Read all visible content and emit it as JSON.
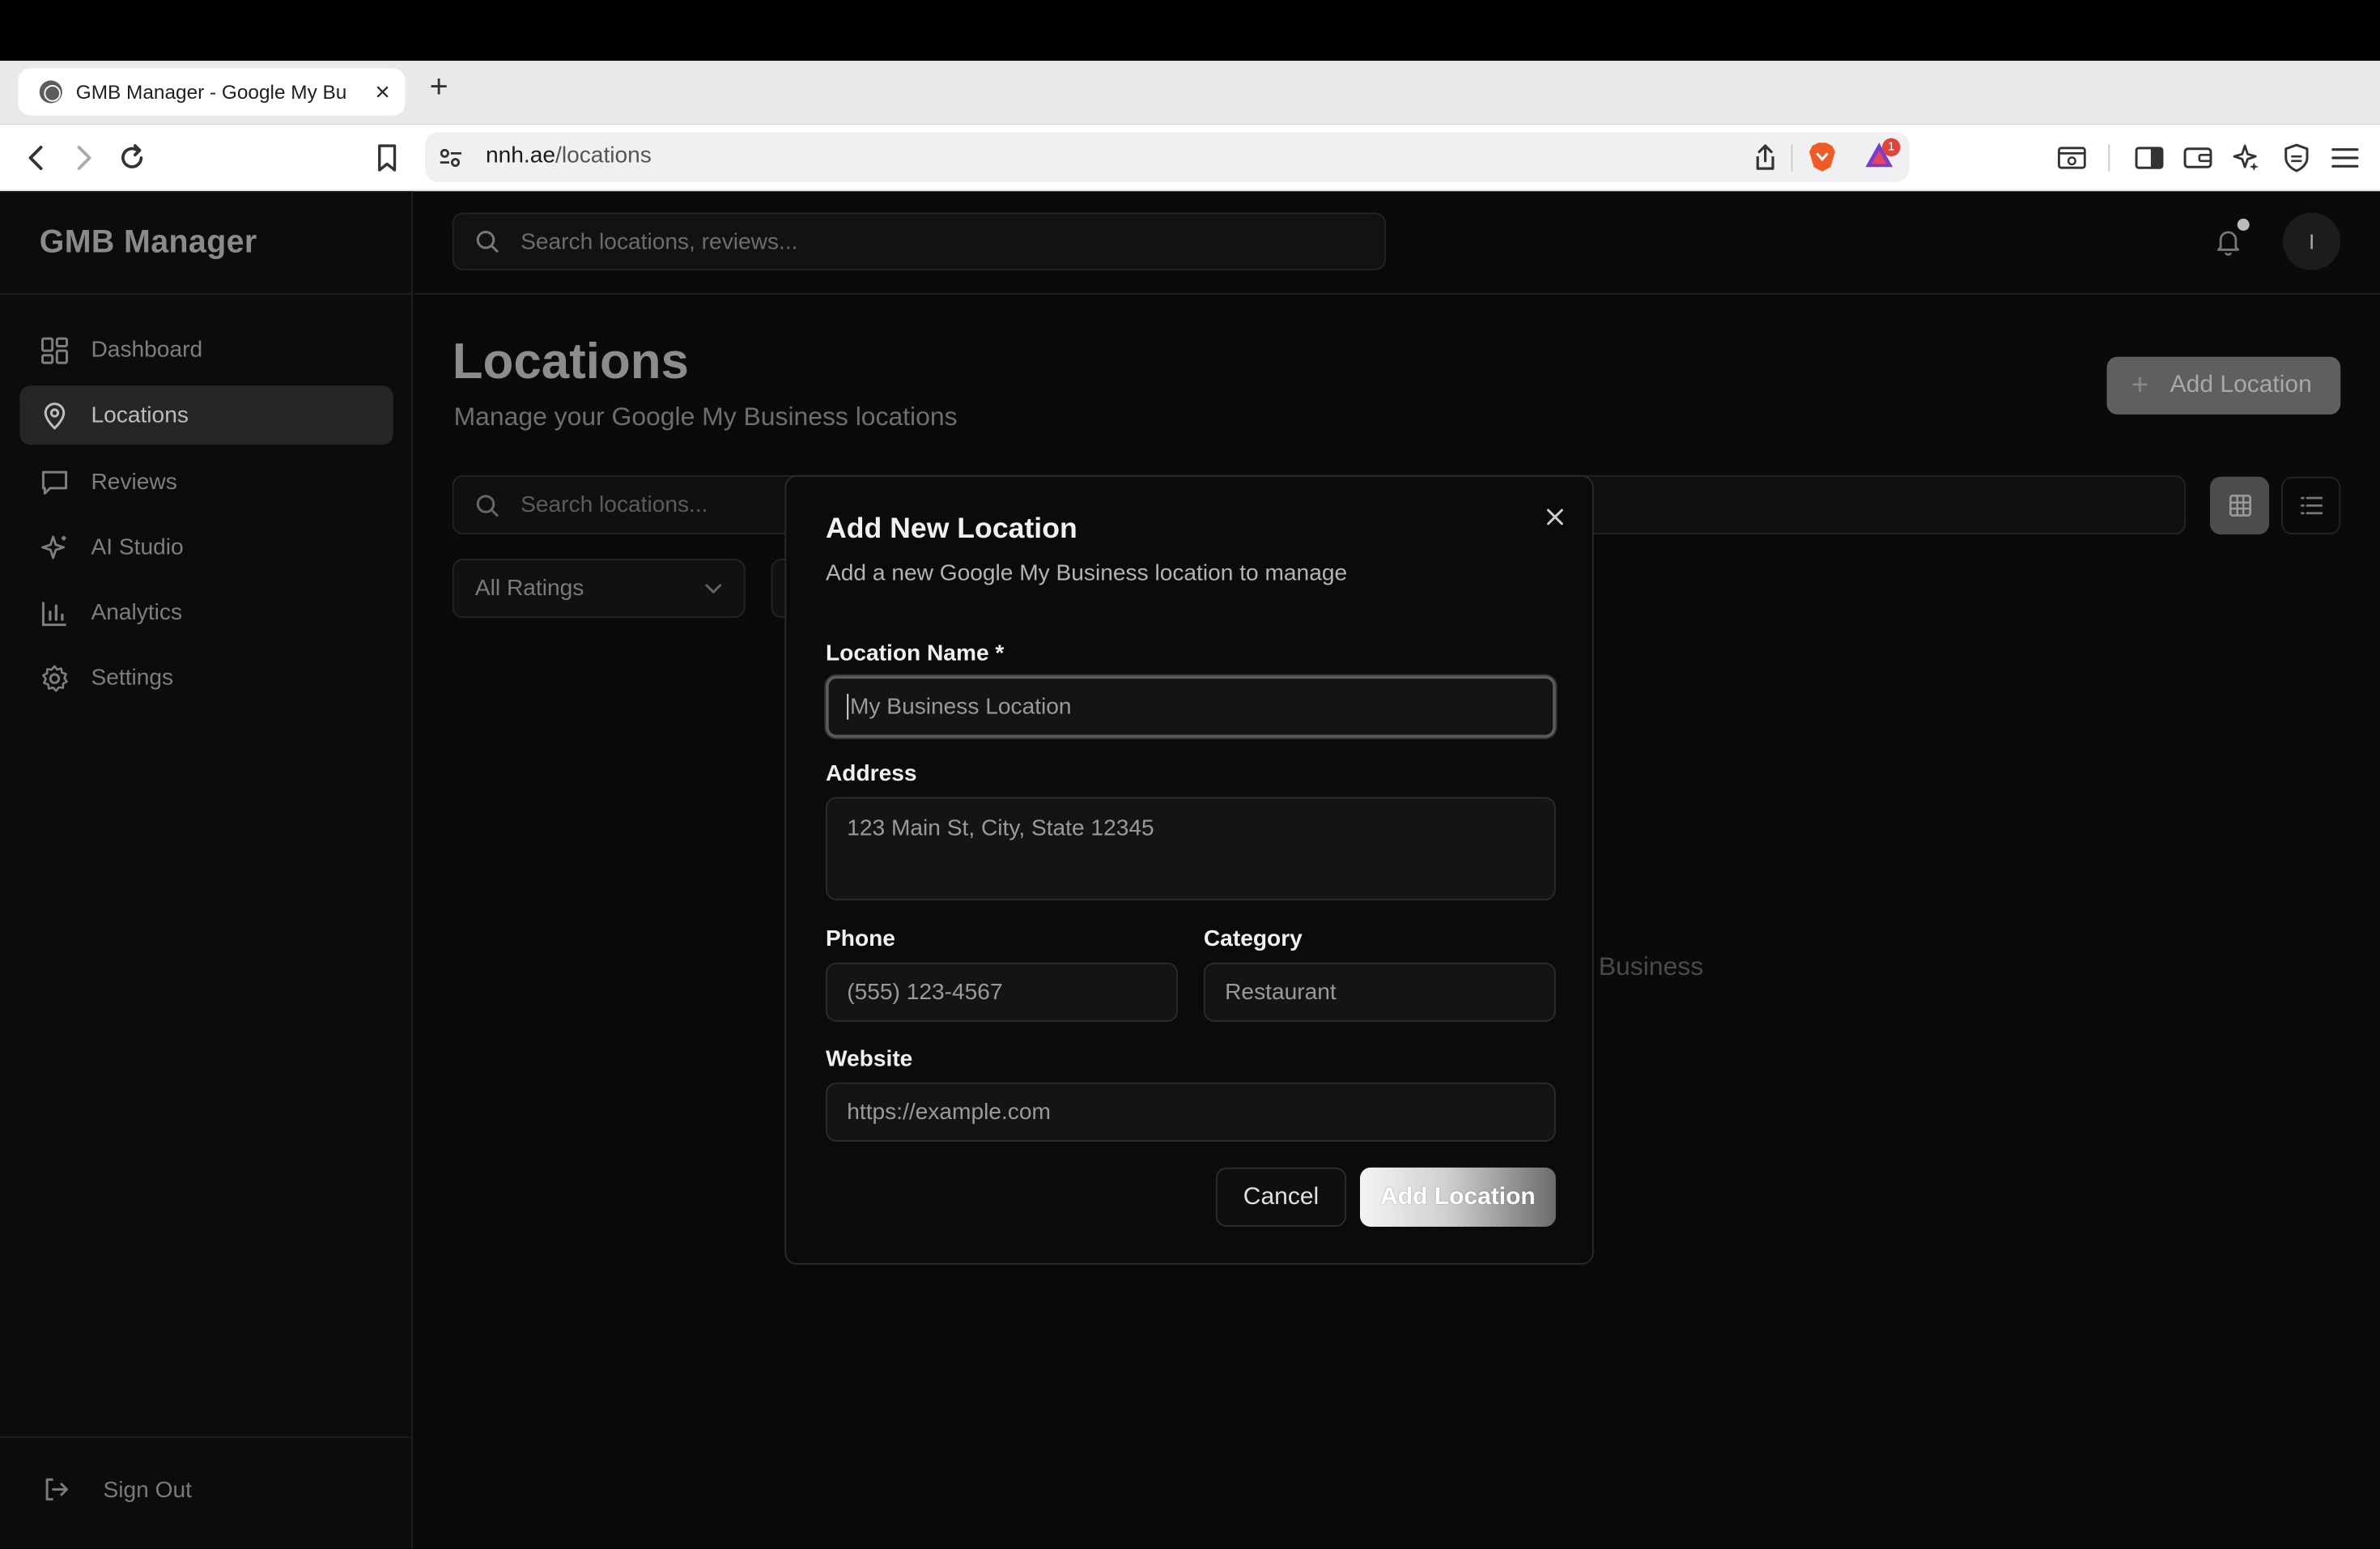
{
  "browser": {
    "tab_title": "GMB Manager - Google My Bu",
    "url_host": "nnh.ae",
    "url_path": "/locations",
    "extension_badge": "1"
  },
  "sidebar": {
    "brand": "GMB Manager",
    "items": [
      {
        "label": "Dashboard",
        "icon": "dashboard-icon"
      },
      {
        "label": "Locations",
        "icon": "map-pin-icon",
        "active": true
      },
      {
        "label": "Reviews",
        "icon": "message-icon"
      },
      {
        "label": "AI Studio",
        "icon": "sparkles-icon"
      },
      {
        "label": "Analytics",
        "icon": "bar-chart-icon"
      },
      {
        "label": "Settings",
        "icon": "gear-icon"
      }
    ],
    "sign_out": "Sign Out"
  },
  "header": {
    "search_placeholder": "Search locations, reviews...",
    "avatar_initial": "I"
  },
  "main": {
    "title": "Locations",
    "subtitle": "Manage your Google My Business locations",
    "add_button": "Add Location",
    "search_placeholder": "Search locations...",
    "ratings_filter": "All Ratings",
    "empty_text_fragment": "y Business"
  },
  "dialog": {
    "title": "Add New Location",
    "subtitle": "Add a new Google My Business location to manage",
    "fields": {
      "name": {
        "label": "Location Name *",
        "placeholder": "My Business Location"
      },
      "address": {
        "label": "Address",
        "placeholder": "123 Main St, City, State 12345"
      },
      "phone": {
        "label": "Phone",
        "placeholder": "(555) 123-4567"
      },
      "category": {
        "label": "Category",
        "placeholder": "Restaurant"
      },
      "website": {
        "label": "Website",
        "placeholder": "https://example.com"
      }
    },
    "cancel": "Cancel",
    "submit": "Add Location"
  },
  "colors": {
    "background": "#0a0a0a",
    "dialog": "#0b0b0b",
    "active_nav": "#262626"
  }
}
